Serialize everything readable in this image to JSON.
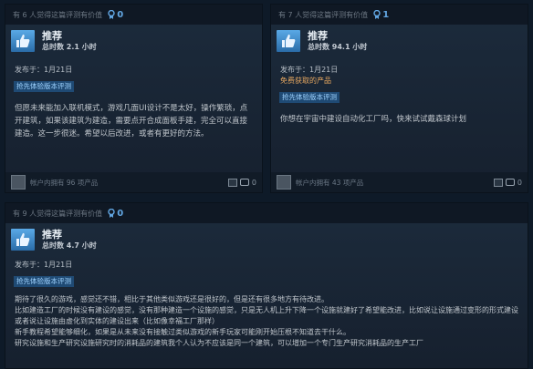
{
  "reviews": [
    {
      "helpful_text": "有 6 人觉得这篇评测有价值",
      "award_count": "0",
      "recommendation": "推荐",
      "hours": "总时数 2.1 小时",
      "posted": "发布于：1月21日",
      "badge": "抢先体验版本评测",
      "text": "但愿未来能加入联机模式，游戏几面UI设计不是太好，操作繁琐，点开建筑，如果该建筑为建造，需要点开合成面板手建，完全可以直接建造。这一步很迷。希望以后改进，或者有更好的方法。",
      "footer_products": "帐户内拥有 96 项产品",
      "comments": "0"
    },
    {
      "helpful_text": "有 7 人觉得这篇评测有价值",
      "award_count": "1",
      "recommendation": "推荐",
      "hours": "总时数 94.1 小时",
      "posted": "发布于：1月21日",
      "free_label": "免费获取的产品",
      "badge": "抢先体验版本评测",
      "text": "你想在宇宙中建设自动化工厂吗，快来试试戴森球计划",
      "footer_products": "帐户内拥有 43 项产品",
      "comments": "0"
    },
    {
      "helpful_text": "有 9 人觉得这篇评测有价值",
      "award_count": "0",
      "recommendation": "推荐",
      "hours": "总时数 4.7 小时",
      "posted": "发布于：1月21日",
      "badge": "抢先体验版本评测",
      "text_lines": [
        "期待了很久的游戏，感觉还不错，相比于其他类似游戏还是很好的，但是还有很多地方有待改进。",
        "比如建造工厂的时候没有建设的感觉，没有那种建造一个设施的感觉，只是无人机上升下降一个设施就建好了希望能改进，比如说让设施通过变形的形式建设或者说让设施由虚化到实体的建设出来（比如像幸福工厂那样）",
        "新手教程希望能够细化，如果是从未来没有接触过类似游戏的新手玩家可能刚开始压根不知道去干什么。",
        "研究设施和生产研究设施研究时的消耗品的建筑我个人认为不应该是同一个建筑，可以增加一个专门生产研究消耗品的生产工厂"
      ]
    }
  ],
  "colors": {
    "accent": "#62a7e3",
    "badge_bg": "#1f4a74",
    "free": "#e8a860"
  },
  "icons": {
    "thumb": "thumbs-up-icon",
    "award": "award-icon",
    "comment": "comment-icon"
  }
}
